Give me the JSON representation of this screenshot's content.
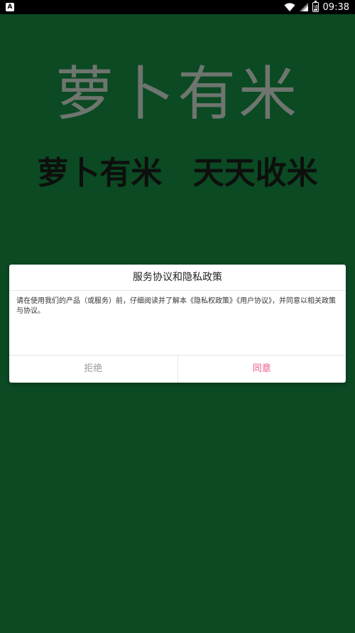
{
  "status_bar": {
    "app_badge": "A",
    "battery_level": "8",
    "time": "09:38",
    "icons": [
      "wifi-icon",
      "sim-signal-icon",
      "battery-icon"
    ]
  },
  "splash": {
    "logo_text": "萝卜有米",
    "slogan_left": "萝卜有米",
    "slogan_right": "天天收米",
    "colors": {
      "background": "#0b4a23",
      "logo_text": "#6f756f",
      "slogan_text": "#0d0f0d"
    }
  },
  "dialog": {
    "title": "服务协议和隐私政策",
    "body": "请在使用我们的产品（或服务）前，仔细阅读并了解本《隐私权政策》《用户协议》，并同意以相关政策与协议。",
    "refuse_label": "拒绝",
    "agree_label": "同意",
    "colors": {
      "agree": "#e8568a",
      "refuse": "#9a9a9a"
    }
  }
}
